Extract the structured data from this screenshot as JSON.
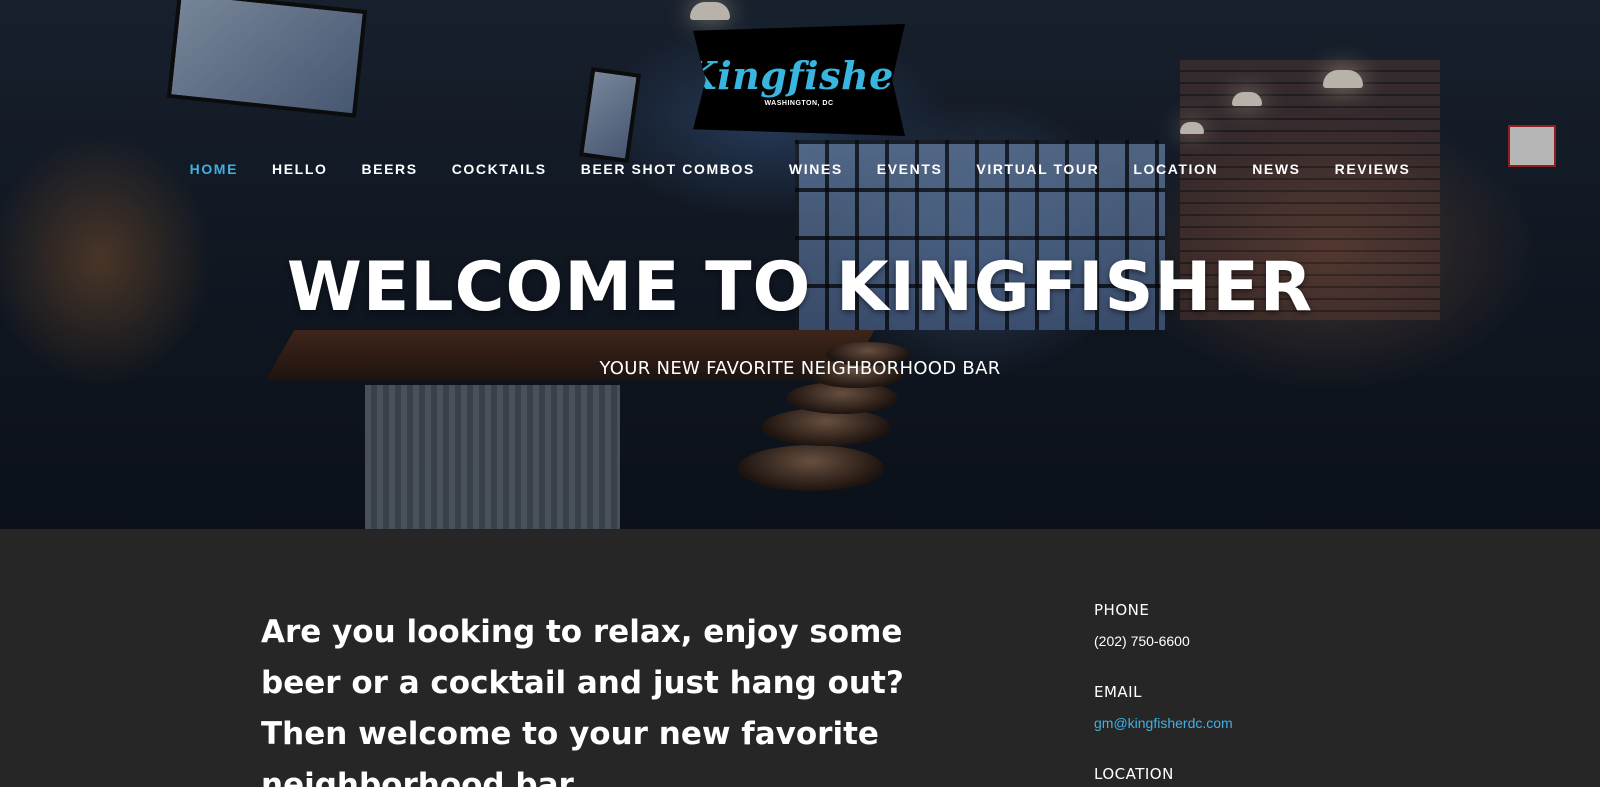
{
  "logo": {
    "wordmark": "Kingfisher",
    "location": "WASHINGTON, DC"
  },
  "nav": {
    "items": [
      {
        "label": "HOME",
        "active": true
      },
      {
        "label": "HELLO"
      },
      {
        "label": "BEERS"
      },
      {
        "label": "COCKTAILS"
      },
      {
        "label": "BEER SHOT COMBOS"
      },
      {
        "label": "WINES"
      },
      {
        "label": "EVENTS"
      },
      {
        "label": "VIRTUAL TOUR"
      },
      {
        "label": "LOCATION"
      },
      {
        "label": "NEWS"
      },
      {
        "label": "REVIEWS"
      }
    ]
  },
  "hero": {
    "title": "WELCOME TO KINGFISHER",
    "subtitle": "YOUR NEW FAVORITE NEIGHBORHOOD BAR"
  },
  "intro": {
    "text": "Are you looking to relax, enjoy some beer or a cocktail and just hang out?  Then welcome to your new favorite neighborhood bar"
  },
  "contact": {
    "phone_label": "PHONE",
    "phone": "(202) 750-6600",
    "email_label": "EMAIL",
    "email": "gm@kingfisherdc.com",
    "location_label": "LOCATION"
  },
  "colors": {
    "accent": "#3fb1e5",
    "background": "#262626"
  }
}
